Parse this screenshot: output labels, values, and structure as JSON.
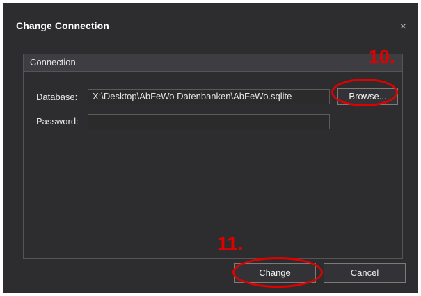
{
  "dialog": {
    "title": "Change Connection",
    "close_symbol": "×"
  },
  "group": {
    "header": "Connection",
    "database_label": "Database:",
    "database_value": "X:\\Desktop\\AbFeWo Datenbanken\\AbFeWo.sqlite",
    "browse_label": "Browse...",
    "password_label": "Password:",
    "password_value": ""
  },
  "footer": {
    "change_label": "Change",
    "cancel_label": "Cancel"
  },
  "annotations": {
    "step_10": "10.",
    "step_11": "11.",
    "color": "#e00000"
  },
  "icons": {
    "close": "close-icon"
  }
}
